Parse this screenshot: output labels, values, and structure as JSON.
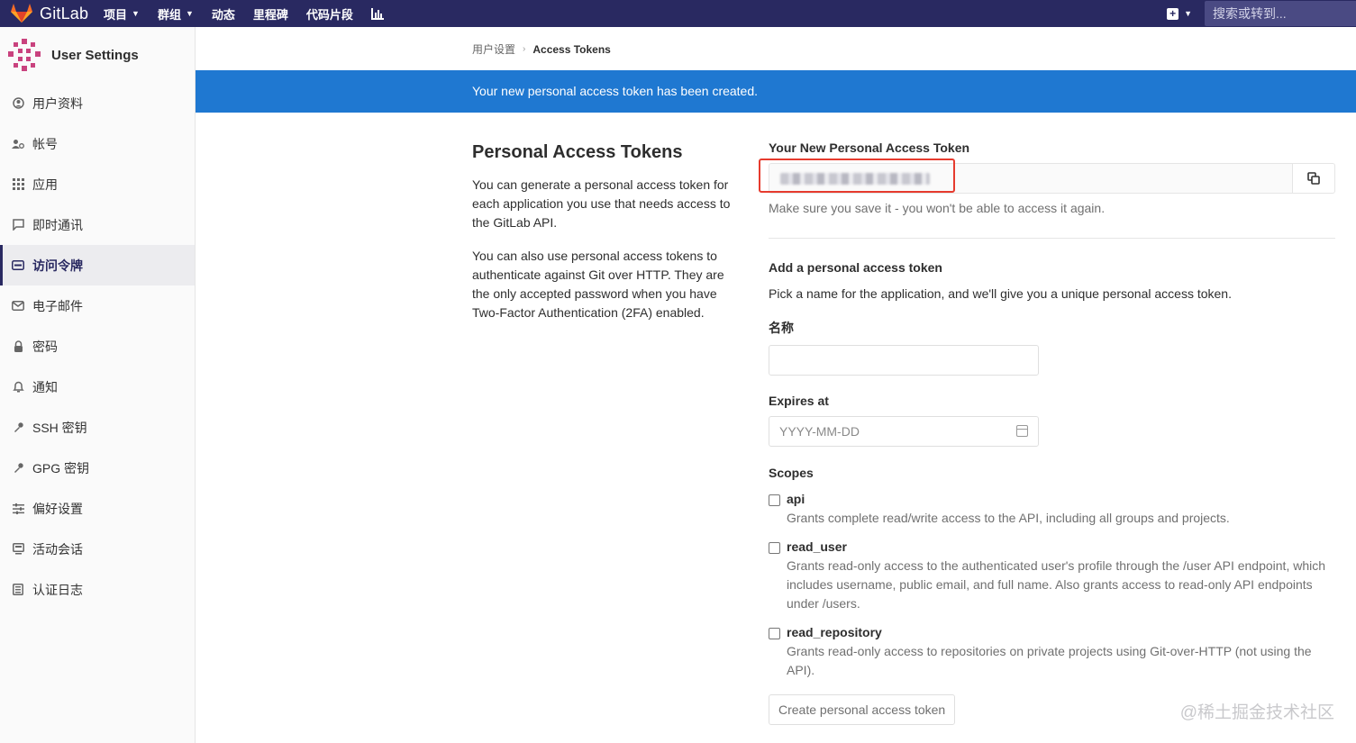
{
  "navbar": {
    "brand": "GitLab",
    "items": [
      {
        "label": "项目",
        "dropdown": true
      },
      {
        "label": "群组",
        "dropdown": true
      },
      {
        "label": "动态",
        "dropdown": false
      },
      {
        "label": "里程碑",
        "dropdown": false
      },
      {
        "label": "代码片段",
        "dropdown": false
      }
    ],
    "search_placeholder": "搜索或转到...",
    "colors": {
      "bar": "#292961",
      "search": "#4a4a83"
    }
  },
  "sidebar": {
    "title": "User Settings",
    "items": [
      {
        "label": "用户资料",
        "icon": "profile-icon"
      },
      {
        "label": "帐号",
        "icon": "account-icon"
      },
      {
        "label": "应用",
        "icon": "applications-icon"
      },
      {
        "label": "即时通讯",
        "icon": "chat-icon"
      },
      {
        "label": "访问令牌",
        "icon": "token-icon",
        "active": true
      },
      {
        "label": "电子邮件",
        "icon": "email-icon"
      },
      {
        "label": "密码",
        "icon": "lock-icon"
      },
      {
        "label": "通知",
        "icon": "bell-icon"
      },
      {
        "label": "SSH 密钥",
        "icon": "key-icon"
      },
      {
        "label": "GPG 密钥",
        "icon": "key-icon"
      },
      {
        "label": "偏好设置",
        "icon": "preferences-icon"
      },
      {
        "label": "活动会话",
        "icon": "monitor-icon"
      },
      {
        "label": "认证日志",
        "icon": "log-icon"
      }
    ]
  },
  "breadcrumb": {
    "parent": "用户设置",
    "current": "Access Tokens"
  },
  "flash": {
    "message": "Your new personal access token has been created.",
    "color": "#1f78d1"
  },
  "info": {
    "title": "Personal Access Tokens",
    "para1": "You can generate a personal access token for each application you use that needs access to the GitLab API.",
    "para2": "You can also use personal access tokens to authenticate against Git over HTTP. They are the only accepted password when you have Two-Factor Authentication (2FA) enabled."
  },
  "form": {
    "new_token_label": "Your New Personal Access Token",
    "new_token_help": "Make sure you save it - you won't be able to access it again.",
    "add_title": "Add a personal access token",
    "add_desc": "Pick a name for the application, and we'll give you a unique personal access token.",
    "name_label": "名称",
    "expires_label": "Expires at",
    "expires_placeholder": "YYYY-MM-DD",
    "scopes_label": "Scopes",
    "scopes": [
      {
        "name": "api",
        "desc": "Grants complete read/write access to the API, including all groups and projects.",
        "checked": false
      },
      {
        "name": "read_user",
        "desc": "Grants read-only access to the authenticated user's profile through the /user API endpoint, which includes username, public email, and full name. Also grants access to read-only API endpoints under /users.",
        "checked": false
      },
      {
        "name": "read_repository",
        "desc": "Grants read-only access to repositories on private projects using Git-over-HTTP (not using the API).",
        "checked": false
      }
    ],
    "submit_label": "Create personal access token"
  },
  "watermark": "@稀土掘金技术社区"
}
